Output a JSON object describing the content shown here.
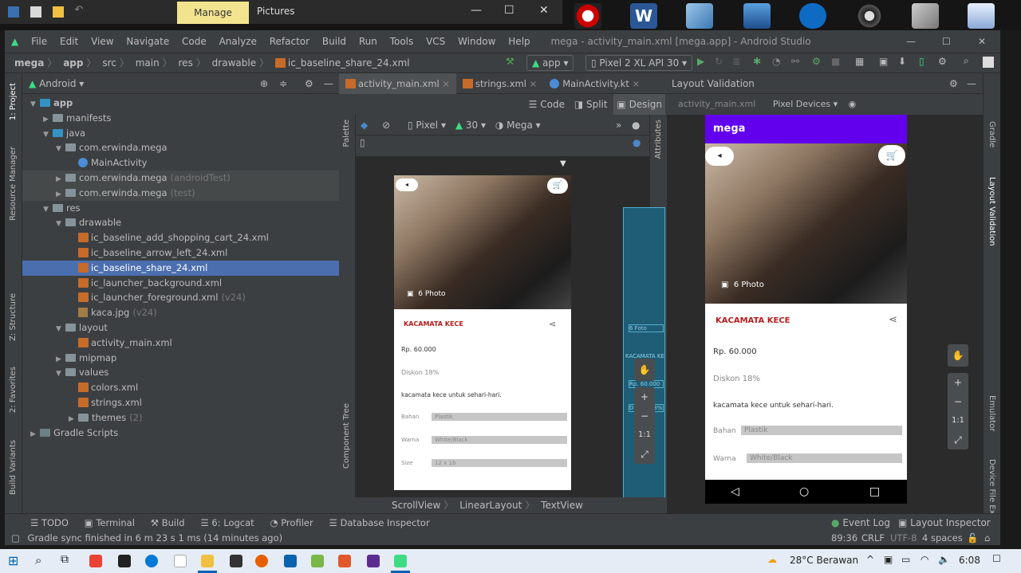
{
  "os": {
    "ribbon_manage": "Manage",
    "ribbon_pictures": "Pictures",
    "desktop_icons": [
      "app-icon",
      "word-icon",
      "box-icon",
      "computer-icon",
      "teamviewer-icon",
      "webcam-icon",
      "tools-icon",
      "recycle-bin-icon"
    ]
  },
  "menubar": {
    "items": [
      "File",
      "Edit",
      "View",
      "Navigate",
      "Code",
      "Analyze",
      "Refactor",
      "Build",
      "Run",
      "Tools",
      "VCS",
      "Window",
      "Help"
    ],
    "title": "mega - activity_main.xml [mega.app] - Android Studio"
  },
  "breadcrumb": [
    "mega",
    "app",
    "src",
    "main",
    "res",
    "drawable",
    "ic_baseline_share_24.xml"
  ],
  "toolbar": {
    "module": "app",
    "device": "Pixel 2 XL API 30"
  },
  "project": {
    "view": "Android",
    "tree": [
      {
        "label": "app",
        "icon": "module",
        "depth": 0,
        "open": true
      },
      {
        "label": "manifests",
        "icon": "folder",
        "depth": 1,
        "open": false
      },
      {
        "label": "java",
        "icon": "folder",
        "depth": 1,
        "open": true
      },
      {
        "label": "com.erwinda.mega",
        "icon": "package",
        "depth": 2,
        "open": true
      },
      {
        "label": "MainActivity",
        "icon": "kotlin",
        "depth": 3
      },
      {
        "label": "com.erwinda.mega",
        "suffix": "(androidTest)",
        "icon": "package",
        "depth": 2,
        "open": false,
        "test": true
      },
      {
        "label": "com.erwinda.mega",
        "suffix": "(test)",
        "icon": "package",
        "depth": 2,
        "open": false,
        "test": true
      },
      {
        "label": "res",
        "icon": "folder",
        "depth": 1,
        "open": true
      },
      {
        "label": "drawable",
        "icon": "folder",
        "depth": 2,
        "open": true
      },
      {
        "label": "ic_baseline_add_shopping_cart_24.xml",
        "icon": "xml",
        "depth": 3
      },
      {
        "label": "ic_baseline_arrow_left_24.xml",
        "icon": "xml",
        "depth": 3
      },
      {
        "label": "ic_baseline_share_24.xml",
        "icon": "xml",
        "depth": 3,
        "selected": true
      },
      {
        "label": "ic_launcher_background.xml",
        "icon": "xml",
        "depth": 3
      },
      {
        "label": "ic_launcher_foreground.xml",
        "suffix": "(v24)",
        "icon": "xml",
        "depth": 3
      },
      {
        "label": "kaca.jpg",
        "suffix": "(v24)",
        "icon": "image",
        "depth": 3
      },
      {
        "label": "layout",
        "icon": "folder",
        "depth": 2,
        "open": true
      },
      {
        "label": "activity_main.xml",
        "icon": "xml",
        "depth": 3
      },
      {
        "label": "mipmap",
        "icon": "folder",
        "depth": 2,
        "open": false
      },
      {
        "label": "values",
        "icon": "folder",
        "depth": 2,
        "open": true
      },
      {
        "label": "colors.xml",
        "icon": "xml",
        "depth": 3
      },
      {
        "label": "strings.xml",
        "icon": "xml",
        "depth": 3
      },
      {
        "label": "themes",
        "suffix": "(2)",
        "icon": "folder",
        "depth": 3,
        "open": false
      },
      {
        "label": "Gradle Scripts",
        "icon": "gradle",
        "depth": 0,
        "open": false
      }
    ]
  },
  "left_strip": [
    "1: Project",
    "Resource Manager",
    "Z: Structure",
    "2: Favorites",
    "Build Variants"
  ],
  "right_strip": [
    "Gradle",
    "Layout Validation",
    "Emulator",
    "Device File Explorer"
  ],
  "editor": {
    "tabs": [
      "activity_main.xml",
      "strings.xml",
      "MainActivity.kt"
    ],
    "modes": [
      "Code",
      "Split",
      "Design"
    ],
    "design_toolbar": {
      "device": "Pixel",
      "api": "30",
      "theme": "Mega"
    },
    "palette_label": "Palette",
    "component_tree_label": "Component Tree",
    "attributes_label": "Attributes",
    "footer": [
      "ScrollView",
      "LinearLayout",
      "TextView"
    ]
  },
  "product": {
    "photo_badge": "6 Photo",
    "title": "KACAMATA KECE",
    "price": "Rp. 60.000",
    "discount": "Diskon 18%",
    "description": "kacamata kece untuk sehari-hari.",
    "specs": [
      {
        "label": "Bahan",
        "value": "Plastik"
      },
      {
        "label": "Warna",
        "value": "White/Black"
      },
      {
        "label": "Size",
        "value": "12 x 16"
      }
    ]
  },
  "blueprint_labels": [
    "6 Foto",
    "KACAMATA KE",
    "Rp. 60.000",
    "Diskon 18%"
  ],
  "layout_validation": {
    "title": "Layout Validation",
    "file": "activity_main.xml",
    "devices": "Pixel Devices",
    "app_title": "mega",
    "app_bar_color": "#6200ee"
  },
  "zoom": {
    "ratio_label": "1:1"
  },
  "tools": [
    "TODO",
    "Terminal",
    "Build",
    "6: Logcat",
    "Profiler",
    "Database Inspector"
  ],
  "tools_right": [
    "Event Log",
    "Layout Inspector"
  ],
  "status": {
    "message": "Gradle sync finished in 6 m 23 s 1 ms (14 minutes ago)",
    "position": "89:36",
    "line_sep": "CRLF",
    "encoding": "UTF-8",
    "indent": "4 spaces"
  },
  "taskbar": {
    "weather": "28°C  Berawan",
    "time": "6:08"
  },
  "colors": {
    "accent": "#4b6eaf",
    "price_title": "#b71c1c",
    "purple": "#6200ee"
  }
}
